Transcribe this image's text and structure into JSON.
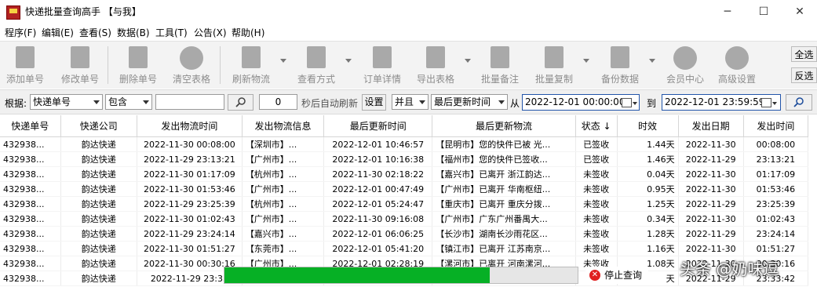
{
  "window": {
    "title": "快递批量查询高手 【与我】",
    "minimize": "─",
    "maximize": "☐",
    "close": "✕"
  },
  "menu": [
    "程序(F)",
    "编辑(E)",
    "查看(S)",
    "数据(B)",
    "工具(T)",
    "公告(X)",
    "帮助(H)"
  ],
  "toolbar": [
    {
      "label": "添加单号",
      "icon": "add-document-icon"
    },
    {
      "label": "修改单号",
      "icon": "edit-pencil-icon"
    },
    {
      "label": "删除单号",
      "icon": "delete-document-icon"
    },
    {
      "label": "清空表格",
      "icon": "clear-x-icon"
    },
    {
      "label": "刷新物流",
      "icon": "refresh-document-icon"
    },
    {
      "label": "查看方式",
      "icon": "view-document-icon"
    },
    {
      "label": "订单详情",
      "icon": "order-detail-icon"
    },
    {
      "label": "导出表格",
      "icon": "export-icon"
    },
    {
      "label": "批量备注",
      "icon": "note-icon"
    },
    {
      "label": "批量复制",
      "icon": "copy-icon"
    },
    {
      "label": "备份数据",
      "icon": "backup-icon"
    },
    {
      "label": "会员中心",
      "icon": "clock-icon"
    },
    {
      "label": "高级设置",
      "icon": "settings-gear-icon"
    }
  ],
  "side": {
    "select_all": "全选",
    "invert": "反选"
  },
  "filter": {
    "label_by": "根据:",
    "field": "快递单号",
    "match": "包含",
    "keyword": "",
    "refresh_seconds": "0",
    "auto_refresh_label": "秒后自动刷新",
    "settings_button": "设置",
    "logic": "并且",
    "time_field": "最后更新时间",
    "from_label": "从",
    "from_value": "2022-12-01 00:00:00",
    "to_label": "到",
    "to_value": "2022-12-01 23:59:59"
  },
  "table": {
    "columns": [
      "快递单号",
      "快递公司",
      "发出物流时间",
      "发出物流信息",
      "最后更新时间",
      "最后更新物流",
      "状态 ↓",
      "时效",
      "发出日期",
      "发出时间"
    ],
    "rows": [
      [
        "432938...",
        "韵达快递",
        "2022-11-30 00:08:00",
        "【深圳市】...",
        "2022-12-01 10:46:57",
        "【昆明市】您的快件已被 光...",
        "已签收",
        "1.44天",
        "2022-11-30",
        "00:08:00"
      ],
      [
        "432938...",
        "韵达快递",
        "2022-11-29 23:13:21",
        "【广州市】...",
        "2022-12-01 10:16:38",
        "【福州市】您的快件已签收...",
        "已签收",
        "1.46天",
        "2022-11-29",
        "23:13:21"
      ],
      [
        "432938...",
        "韵达快递",
        "2022-11-30 01:17:09",
        "【杭州市】...",
        "2022-11-30 02:18:22",
        "【嘉兴市】已离开 浙江韵达...",
        "未签收",
        "0.04天",
        "2022-11-30",
        "01:17:09"
      ],
      [
        "432938...",
        "韵达快递",
        "2022-11-30 01:53:46",
        "【广州市】...",
        "2022-12-01 00:47:49",
        "【广州市】已离开 华南枢纽...",
        "未签收",
        "0.95天",
        "2022-11-30",
        "01:53:46"
      ],
      [
        "432938...",
        "韵达快递",
        "2022-11-29 23:25:39",
        "【杭州市】...",
        "2022-12-01 05:24:47",
        "【重庆市】已离开 重庆分拨...",
        "未签收",
        "1.25天",
        "2022-11-29",
        "23:25:39"
      ],
      [
        "432938...",
        "韵达快递",
        "2022-11-30 01:02:43",
        "【广州市】...",
        "2022-11-30 09:16:08",
        "【广州市】广东广州番禺大...",
        "未签收",
        "0.34天",
        "2022-11-30",
        "01:02:43"
      ],
      [
        "432938...",
        "韵达快递",
        "2022-11-29 23:24:14",
        "【嘉兴市】...",
        "2022-12-01 06:06:25",
        "【长沙市】湖南长沙雨花区...",
        "未签收",
        "1.28天",
        "2022-11-29",
        "23:24:14"
      ],
      [
        "432938...",
        "韵达快递",
        "2022-11-30 01:51:27",
        "【东莞市】...",
        "2022-12-01 05:41:20",
        "【镇江市】已离开 江苏南京...",
        "未签收",
        "1.16天",
        "2022-11-30",
        "01:51:27"
      ],
      [
        "432938...",
        "韵达快递",
        "2022-11-30 00:30:16",
        "【广州市】...",
        "2022-12-01 02:28:19",
        "【漯河市】已离开 河南漯河...",
        "未签收",
        "1.08天",
        "2022-11-30",
        "00:30:16"
      ],
      [
        "432938...",
        "韵达快递",
        "2022-11-29 23:33",
        "",
        "",
        "",
        "未",
        "天",
        "2022-11-29",
        "23:33:42"
      ]
    ]
  },
  "progress": {
    "fraction": 0.75,
    "color": "#06b025"
  },
  "stop_button": "停止查询",
  "watermark": "头条 @奶味逗"
}
